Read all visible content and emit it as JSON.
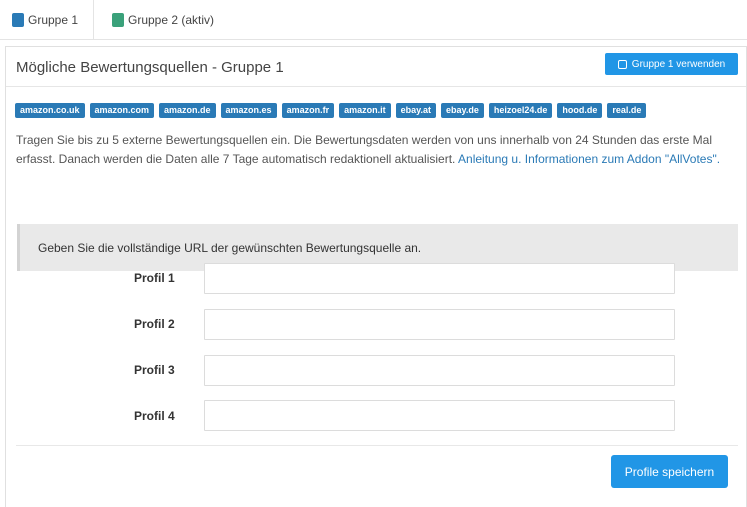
{
  "tabs": [
    {
      "label": "Gruppe 1",
      "color": "#2a7ab6"
    },
    {
      "label": "Gruppe 2 (aktiv)",
      "color": "#3aa17a"
    }
  ],
  "panel": {
    "title": "Mögliche Bewertungsquellen - Gruppe 1",
    "use_button": "Gruppe 1 verwenden"
  },
  "badges": [
    "amazon.co.uk",
    "amazon.com",
    "amazon.de",
    "amazon.es",
    "amazon.fr",
    "amazon.it",
    "ebay.at",
    "ebay.de",
    "heizoel24.de",
    "hood.de",
    "real.de"
  ],
  "description": {
    "text": "Tragen Sie bis zu 5 externe Bewertungsquellen ein. Die Bewertungsdaten werden von uns innerhalb von 24 Stunden das erste Mal erfasst. Danach werden die Daten alle 7 Tage automatisch redaktionell aktualisiert. ",
    "link": "Anleitung u. Informationen zum Addon \"AllVotes\"."
  },
  "notice": "Geben Sie die vollständige URL der gewünschten Bewertungsquelle an.",
  "profiles": [
    {
      "label": "Profil 1",
      "value": ""
    },
    {
      "label": "Profil 2",
      "value": ""
    },
    {
      "label": "Profil 3",
      "value": ""
    },
    {
      "label": "Profil 4",
      "value": ""
    }
  ],
  "save_button": "Profile speichern"
}
